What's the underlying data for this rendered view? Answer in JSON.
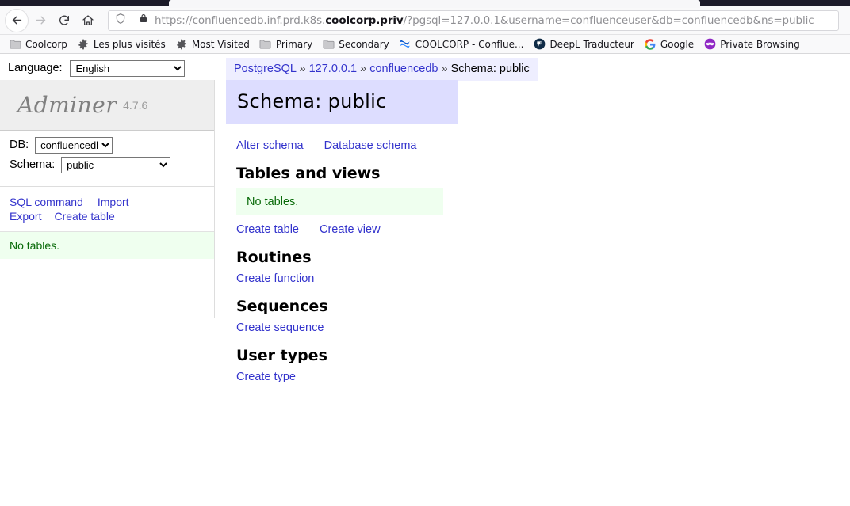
{
  "browser": {
    "nav": {
      "back_label": "Back",
      "forward_label": "Forward",
      "reload_label": "Reload",
      "home_label": "Home"
    },
    "url": {
      "prefix": "https://confluencedb.inf.prd.k8s.",
      "domain": "coolcorp.priv",
      "suffix": "/?pgsql=127.0.0.1&username=confluenceuser&db=confluencedb&ns=public",
      "full": "https://confluencedb.inf.prd.k8s.coolcorp.priv/?pgsql=127.0.0.1&username=confluenceuser&db=confluencedb&ns=public",
      "shield_icon": "shield-icon",
      "lock_icon": "lock-icon"
    },
    "bookmarks": [
      {
        "label": "Coolcorp",
        "icon": "folder-icon"
      },
      {
        "label": "Les plus visités",
        "icon": "gear-icon"
      },
      {
        "label": "Most Visited",
        "icon": "gear-icon"
      },
      {
        "label": "Primary",
        "icon": "folder-icon"
      },
      {
        "label": "Secondary",
        "icon": "folder-icon"
      },
      {
        "label": "COOLCORP - Conflue...",
        "icon": "confluence-icon"
      },
      {
        "label": "DeepL Traducteur",
        "icon": "deepl-icon"
      },
      {
        "label": "Google",
        "icon": "google-icon"
      },
      {
        "label": "Private Browsing",
        "icon": "mask-icon"
      }
    ]
  },
  "language_bar": {
    "label": "Language:",
    "selected": "English",
    "options": [
      "English"
    ]
  },
  "breadcrumb": {
    "items": [
      "PostgreSQL",
      "127.0.0.1",
      "confluencedb",
      "Schema: public"
    ],
    "separator": "»"
  },
  "sidebar": {
    "logo": {
      "name": "Adminer",
      "version": "4.7.6"
    },
    "db": {
      "label": "DB:",
      "selected": "confluencedb",
      "options": [
        "confluencedb"
      ]
    },
    "schema": {
      "label": "Schema:",
      "selected": "public",
      "options": [
        "public"
      ]
    },
    "links": [
      "SQL command",
      "Import",
      "Export",
      "Create table"
    ],
    "status_message": "No tables."
  },
  "main": {
    "title": "Schema: public",
    "top_links": [
      "Alter schema",
      "Database schema"
    ],
    "sections": [
      {
        "heading": "Tables and views",
        "message": "No tables.",
        "links": [
          "Create table",
          "Create view"
        ]
      },
      {
        "heading": "Routines",
        "links": [
          "Create function"
        ]
      },
      {
        "heading": "Sequences",
        "links": [
          "Create sequence"
        ]
      },
      {
        "heading": "User types",
        "links": [
          "Create type"
        ]
      }
    ]
  },
  "colors": {
    "link": "#3333cc",
    "title_bg": "#ddddff",
    "ok_bg": "#efffef",
    "ok_fg": "#0a6b0a",
    "sidebar_bg": "#eeeeee"
  }
}
